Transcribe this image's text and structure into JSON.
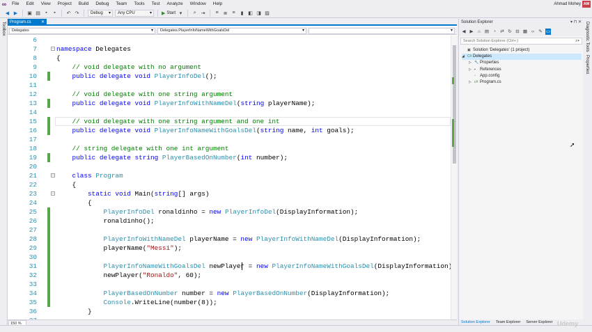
{
  "menu": {
    "items": [
      "File",
      "Edit",
      "View",
      "Project",
      "Build",
      "Debug",
      "Team",
      "Tools",
      "Test",
      "Analyze",
      "Window",
      "Help"
    ],
    "user": "Ahmad Mohey",
    "avatar_initials": "AM"
  },
  "toolbar": {
    "config": "Debug",
    "platform": "Any CPU",
    "start_label": "Start"
  },
  "side_strips": {
    "left": "Toolbox",
    "right_1": "Diagnostic Tools",
    "right_2": "Properties"
  },
  "editor": {
    "tab_label": "Program.cs",
    "nav_project": "Delegates",
    "nav_member": "Delegates.PlayerInfoNameWithGoalsDel",
    "zoom": "150 %",
    "lines": [
      {
        "n": "6",
        "tokens": []
      },
      {
        "n": "7",
        "tokens": [
          [
            "kw",
            "namespace"
          ],
          [
            "pl",
            " Delegates"
          ]
        ]
      },
      {
        "n": "8",
        "tokens": [
          [
            "pl",
            "{"
          ]
        ]
      },
      {
        "n": "9",
        "tokens": [
          [
            "cm",
            "    // void delegate with no argument"
          ]
        ]
      },
      {
        "n": "10",
        "tokens": [
          [
            "kw",
            "    public delegate void "
          ],
          [
            "ty",
            "PlayerInfoDel"
          ],
          [
            "pl",
            "();"
          ]
        ]
      },
      {
        "n": "11",
        "tokens": []
      },
      {
        "n": "12",
        "tokens": [
          [
            "cm",
            "    // void delegate with one string argument"
          ]
        ]
      },
      {
        "n": "13",
        "tokens": [
          [
            "kw",
            "    public delegate void "
          ],
          [
            "ty",
            "PlayerInfoWithNameDel"
          ],
          [
            "pl",
            "("
          ],
          [
            "kw",
            "string"
          ],
          [
            "pl",
            " playerName);"
          ]
        ]
      },
      {
        "n": "14",
        "tokens": []
      },
      {
        "n": "15",
        "tokens": [
          [
            "cm",
            "    // void delegate with one string argument and one int"
          ]
        ]
      },
      {
        "n": "16",
        "tokens": [
          [
            "kw",
            "    public delegate void "
          ],
          [
            "ty",
            "PlayerInfoNameWithGoalsDel"
          ],
          [
            "pl",
            "("
          ],
          [
            "kw",
            "string"
          ],
          [
            "pl",
            " name, "
          ],
          [
            "kw",
            "int"
          ],
          [
            "pl",
            " goals);"
          ]
        ]
      },
      {
        "n": "17",
        "tokens": []
      },
      {
        "n": "18",
        "tokens": [
          [
            "cm",
            "    // string delegate with one int argument"
          ]
        ]
      },
      {
        "n": "19",
        "tokens": [
          [
            "kw",
            "    public delegate string "
          ],
          [
            "ty",
            "PlayerBasedOnNumber"
          ],
          [
            "pl",
            "("
          ],
          [
            "kw",
            "int"
          ],
          [
            "pl",
            " number);"
          ]
        ]
      },
      {
        "n": "20",
        "tokens": []
      },
      {
        "n": "21",
        "tokens": [
          [
            "kw",
            "    class "
          ],
          [
            "ty",
            "Program"
          ]
        ]
      },
      {
        "n": "22",
        "tokens": [
          [
            "pl",
            "    {"
          ]
        ]
      },
      {
        "n": "23",
        "tokens": [
          [
            "kw",
            "        static void "
          ],
          [
            "pl",
            "Main("
          ],
          [
            "kw",
            "string"
          ],
          [
            "pl",
            "[] args)"
          ]
        ]
      },
      {
        "n": "24",
        "tokens": [
          [
            "pl",
            "        {"
          ]
        ]
      },
      {
        "n": "25",
        "tokens": [
          [
            "ty",
            "            PlayerInfoDel"
          ],
          [
            "pl",
            " ronaldinho = "
          ],
          [
            "kw",
            "new "
          ],
          [
            "ty",
            "PlayerInfoDel"
          ],
          [
            "pl",
            "(DisplayInformation);"
          ]
        ]
      },
      {
        "n": "26",
        "tokens": [
          [
            "pl",
            "            ronaldinho();"
          ]
        ]
      },
      {
        "n": "27",
        "tokens": []
      },
      {
        "n": "28",
        "tokens": [
          [
            "ty",
            "            PlayerInfoWithNameDel"
          ],
          [
            "pl",
            " playerName = "
          ],
          [
            "kw",
            "new "
          ],
          [
            "ty",
            "PlayerInfoWithNameDel"
          ],
          [
            "pl",
            "(DisplayInformation);"
          ]
        ]
      },
      {
        "n": "29",
        "tokens": [
          [
            "pl",
            "            playerName("
          ],
          [
            "st",
            "\"Messi\""
          ],
          [
            "pl",
            ");"
          ]
        ]
      },
      {
        "n": "30",
        "tokens": []
      },
      {
        "n": "31",
        "tokens": [
          [
            "ty",
            "            PlayerInfoNameWithGoalsDel"
          ],
          [
            "pl",
            " newPlayer = "
          ],
          [
            "kw",
            "new "
          ],
          [
            "ty",
            "PlayerInfoNameWithGoalsDel"
          ],
          [
            "pl",
            "(DisplayInformation);"
          ]
        ]
      },
      {
        "n": "32",
        "tokens": [
          [
            "pl",
            "            newPlayer("
          ],
          [
            "st",
            "\"Ronaldo\""
          ],
          [
            "pl",
            ", 60);"
          ]
        ]
      },
      {
        "n": "33",
        "tokens": []
      },
      {
        "n": "34",
        "tokens": [
          [
            "ty",
            "            PlayerBasedOnNumber"
          ],
          [
            "pl",
            " number = "
          ],
          [
            "kw",
            "new "
          ],
          [
            "ty",
            "PlayerBasedOnNumber"
          ],
          [
            "pl",
            "(DisplayInformation);"
          ]
        ]
      },
      {
        "n": "35",
        "tokens": [
          [
            "ty",
            "            Console"
          ],
          [
            "pl",
            "."
          ],
          [
            "pl",
            "WriteLine(number(8));"
          ]
        ]
      },
      {
        "n": "36",
        "tokens": [
          [
            "pl",
            "        }"
          ]
        ]
      },
      {
        "n": "37",
        "tokens": []
      }
    ]
  },
  "solution_explorer": {
    "title": "Solution Explorer",
    "search_placeholder": "Search Solution Explorer (Ctrl+;)",
    "tree": [
      {
        "label": "Solution 'Delegates' (1 project)",
        "depth": 0,
        "twisty": "",
        "icon": "solution-icon"
      },
      {
        "label": "Delegates",
        "depth": 0,
        "twisty": "◢",
        "icon": "csharp-project-icon",
        "selected": true
      },
      {
        "label": "Properties",
        "depth": 1,
        "twisty": "▷",
        "icon": "wrench-icon"
      },
      {
        "label": "References",
        "depth": 1,
        "twisty": "▷",
        "icon": "references-icon"
      },
      {
        "label": "App.config",
        "depth": 1,
        "twisty": "",
        "icon": "config-file-icon"
      },
      {
        "label": "Program.cs",
        "depth": 1,
        "twisty": "▷",
        "icon": "csharp-file-icon"
      }
    ],
    "bottom_tabs": [
      "Solution Explorer",
      "Team Explorer",
      "Server Explorer"
    ]
  },
  "watermark": "Udemy"
}
